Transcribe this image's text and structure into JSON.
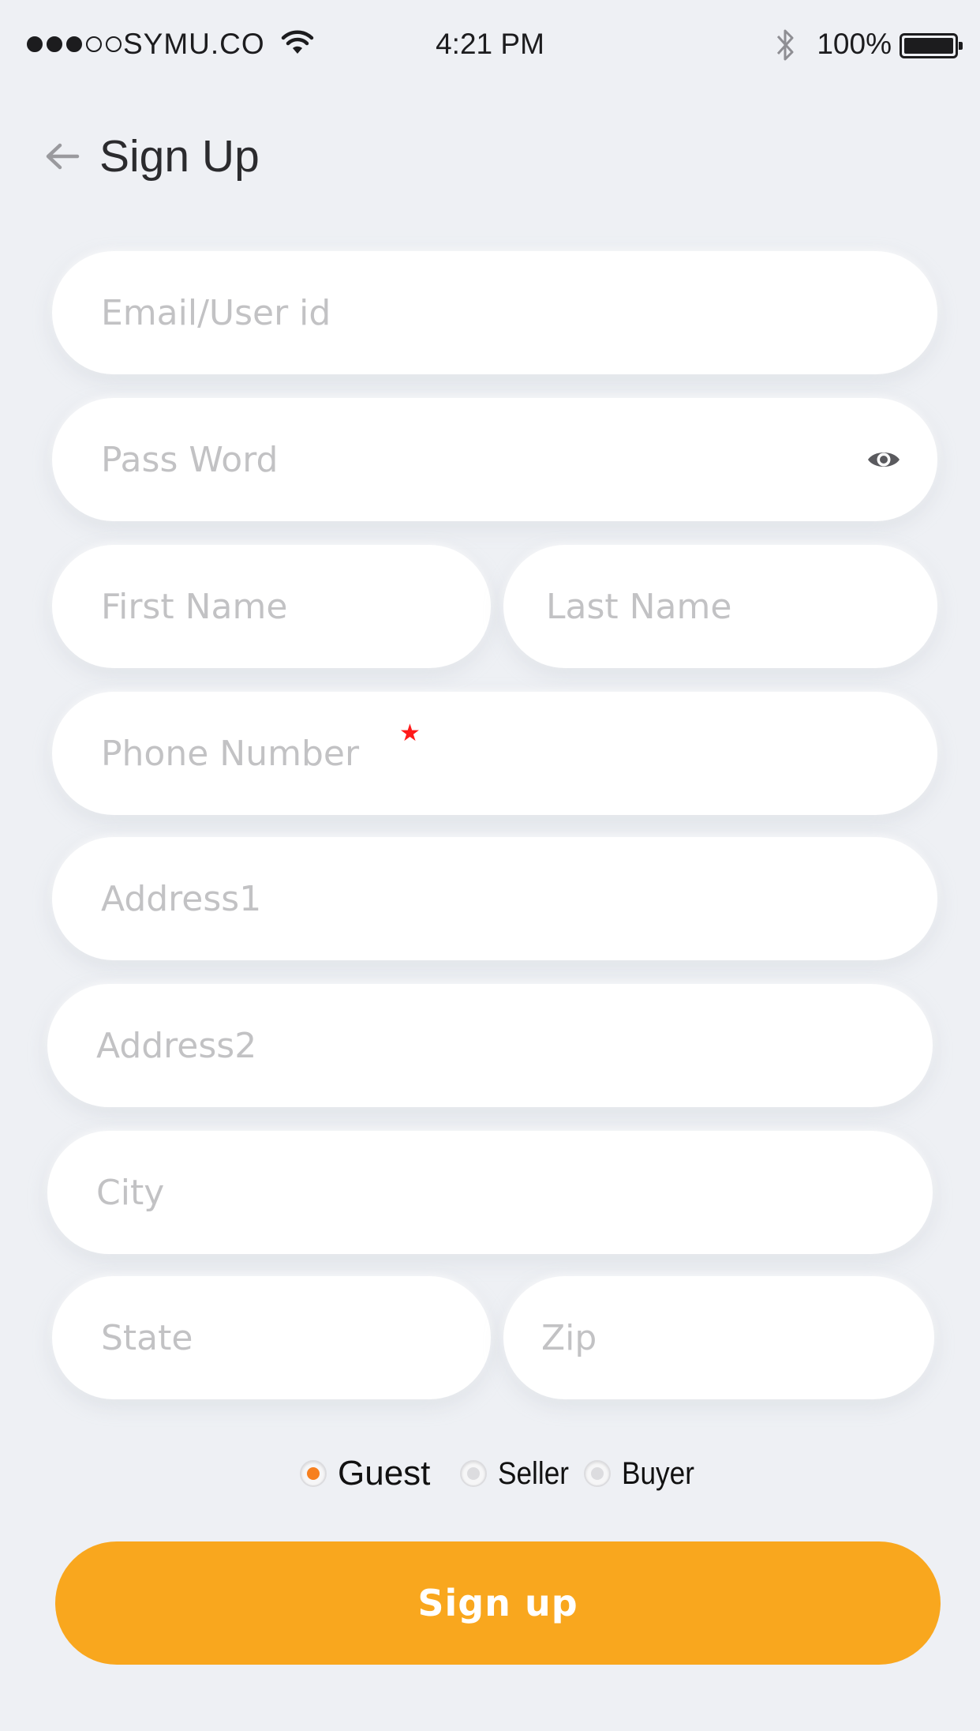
{
  "status_bar": {
    "carrier": "SYMU.CO",
    "time": "4:21 PM",
    "battery_percent": "100%",
    "signal_bars_filled": 3,
    "signal_bars_total": 5
  },
  "header": {
    "title": "Sign Up",
    "back_icon": "arrow-left-icon"
  },
  "form": {
    "email": {
      "placeholder": "Email/User id",
      "value": ""
    },
    "password": {
      "placeholder": "Pass Word",
      "value": "",
      "toggle_icon": "eye-icon"
    },
    "first_name": {
      "placeholder": "First Name",
      "value": ""
    },
    "last_name": {
      "placeholder": "Last Name",
      "value": ""
    },
    "phone": {
      "placeholder": "Phone Number",
      "value": "",
      "required_mark": "★"
    },
    "address1": {
      "placeholder": "Address1",
      "value": ""
    },
    "address2": {
      "placeholder": "Address2",
      "value": ""
    },
    "city": {
      "placeholder": "City",
      "value": ""
    },
    "state": {
      "placeholder": "State",
      "value": ""
    },
    "zip": {
      "placeholder": "Zip",
      "value": ""
    }
  },
  "roles": {
    "options": [
      "Guest",
      "Seller",
      "Buyer"
    ],
    "selected": "Guest"
  },
  "submit": {
    "label": "Sign up"
  },
  "colors": {
    "background": "#eef0f4",
    "accent": "#f9a71e",
    "radio_selected": "#f7801f",
    "required_star": "#ff1a1a",
    "placeholder": "#c2c2c4"
  }
}
